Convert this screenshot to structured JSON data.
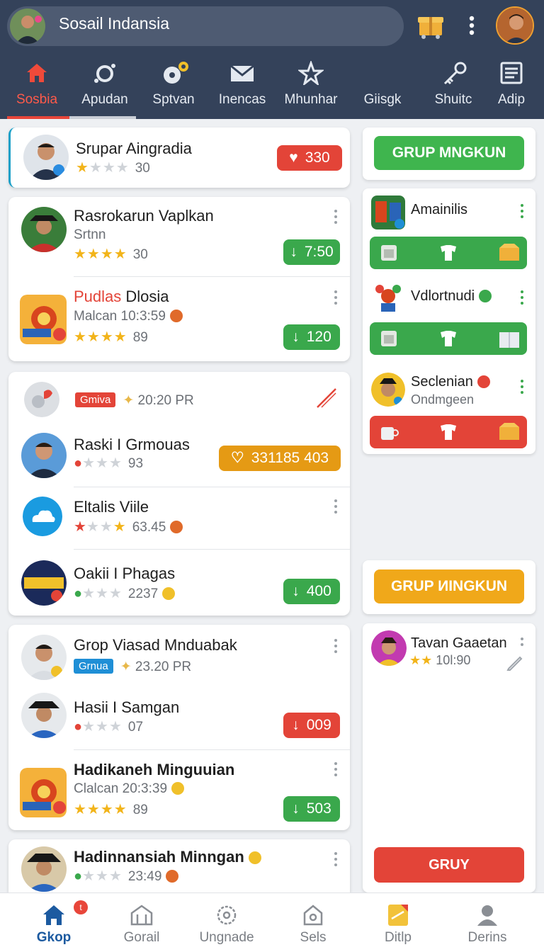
{
  "app": {
    "title": "Sosail Indansia"
  },
  "tabs": [
    {
      "label": "Sosbia",
      "icon": "home-icon"
    },
    {
      "label": "Apudan",
      "icon": "ring-icon"
    },
    {
      "label": "Sptvan",
      "icon": "disc-icon"
    },
    {
      "label": "Inencas",
      "icon": "mail-icon"
    },
    {
      "label": "Mhunhar",
      "icon": "star-icon"
    },
    {
      "label": "Giisgk",
      "icon": "none"
    },
    {
      "label": "Shuitc",
      "icon": "key-icon"
    },
    {
      "label": "Adip",
      "icon": "document-icon"
    }
  ],
  "feed": {
    "card1": {
      "name": "Srupar Aingradia",
      "stars": 1,
      "count": "30",
      "action": "330"
    },
    "card2": [
      {
        "name": "Rasrokarun Vaplkan",
        "sub": "Srtnn",
        "stars": 4,
        "count": "30",
        "action": "7:50"
      },
      {
        "name_red": "Pudlas",
        "name_rest": " Dlosia",
        "sub": "Malcan 10:3:59",
        "stars": 4,
        "count": "89",
        "action": "120"
      }
    ],
    "card3": {
      "header": {
        "tag": "Gmiva",
        "time": "20:20 PR"
      },
      "rows": [
        {
          "name": "Raski I Grmouas",
          "stars": 1,
          "count": "93",
          "action": "331185 403"
        },
        {
          "name": "Eltalis Viile",
          "stars": 2,
          "count": "63.45"
        },
        {
          "name": "Oakii I Phagas",
          "stars": 1,
          "count": "2237",
          "action": "400"
        }
      ]
    },
    "card4": [
      {
        "name": "Grop Viasad Mnduabak",
        "tag": "Grnua",
        "time": "23.20 PR"
      },
      {
        "name": "Hasii I Samgan",
        "stars": 1,
        "count": "07",
        "action": "009"
      },
      {
        "name": "Hadikaneh Minguuian",
        "sub": "Clalcan 20:3:39",
        "stars": 4,
        "count": "89",
        "action": "503"
      }
    ],
    "card5": {
      "name": "Hadinnansiah Minngan",
      "stars": 1,
      "count": "23:49"
    }
  },
  "sidebar": {
    "group_button_1": "GRUP MNGKUN",
    "members": [
      {
        "name": "Amainilis"
      },
      {
        "name": "Vdlortnudi"
      },
      {
        "name": "Seclenian",
        "sub": "Ondmgeen"
      }
    ],
    "group_button_2": "GRUP ИINGKUN",
    "chat": {
      "name": "Tavan Gaaetan",
      "time": "10l:90"
    },
    "bottom_button": "GRUY"
  },
  "bottom_nav": [
    {
      "label": "Gkop",
      "icon": "home-icon",
      "badge": "t"
    },
    {
      "label": "Gorail",
      "icon": "building-icon"
    },
    {
      "label": "Ungnade",
      "icon": "settings-gear-icon"
    },
    {
      "label": "Sels",
      "icon": "house-outline-icon"
    },
    {
      "label": "Ditlp",
      "icon": "note-icon"
    },
    {
      "label": "Derins",
      "icon": "person-icon"
    }
  ],
  "colors": {
    "header": "#34425a",
    "accent_red": "#e34438",
    "accent_green": "#3aa84c",
    "accent_orange": "#e59a14",
    "tab_active": "#ff5a4a"
  }
}
